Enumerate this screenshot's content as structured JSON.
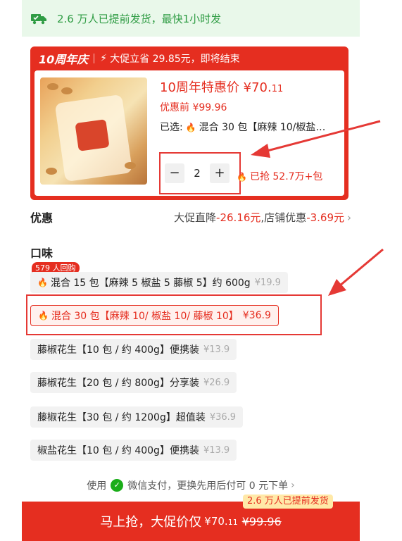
{
  "shipping_bar": {
    "icon": "truck-icon",
    "text": "2.6 万人已提前发货，最快1小时发"
  },
  "promo": {
    "badge": "10周年庆",
    "bolt_icon": "lightning-icon",
    "headline": "大促立省 29.85元，即将结束",
    "price_label": "10周年特惠价 ¥70.",
    "price_decimal": "11",
    "original_price": "优惠前 ¥99.96",
    "selected_prefix": "已选:",
    "selected_value": "混合 30 包【麻辣 10/椒盐…",
    "quantity": "2",
    "minus_label": "−",
    "plus_label": "+",
    "sold_text": "已抢 52.7万+包"
  },
  "coupon": {
    "label": "优惠",
    "prefix": "大促直降",
    "promo_discount": "-26.16元",
    "mid": ",店铺优惠",
    "store_discount": "-3.69元"
  },
  "flavor": {
    "title": "口味",
    "repurchase_badge": "579 人回购",
    "options": [
      {
        "label": "混合 15 包【麻辣 5 椒盐 5 藤椒 5】约 600g",
        "price": "¥19.9"
      },
      {
        "label": "混合 30 包【麻辣 10/ 椒盐 10/ 藤椒 10】",
        "price": "¥36.9"
      },
      {
        "label": "藤椒花生【10 包 / 约 400g】便携装",
        "price": "¥13.9"
      },
      {
        "label": "藤椒花生【20 包 / 约 800g】分享装",
        "price": "¥26.9"
      },
      {
        "label": "藤椒花生【30 包 / 约 1200g】超值装",
        "price": "¥36.9"
      },
      {
        "label": "椒盐花生【10 包 / 约 400g】便携装",
        "price": "¥13.9"
      }
    ]
  },
  "payment": {
    "prefix": "使用",
    "text": "微信支付，更换先用后付可 0 元下单"
  },
  "buy_bar": {
    "shipping_tag": "2.6 万人已提前发货",
    "label": "马上抢，大促价仅",
    "price": "¥70.",
    "price_decimal": "11",
    "original_price": "¥99.96"
  },
  "colors": {
    "accent": "#e52e20",
    "ship_green": "#2f9c44",
    "annotation": "#e53935"
  }
}
